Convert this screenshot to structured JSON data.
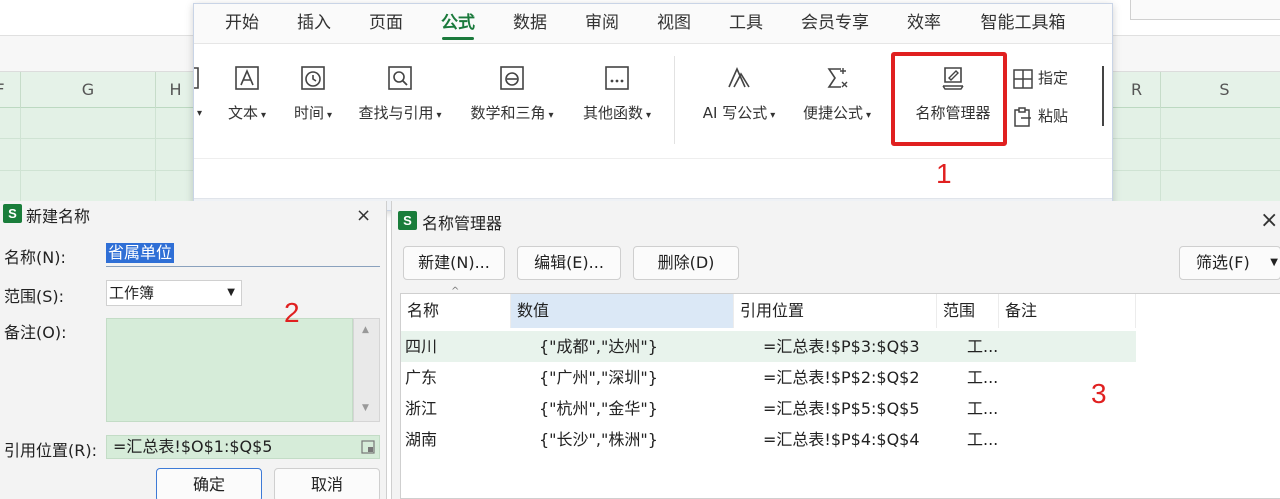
{
  "ribbon": {
    "tabs": [
      {
        "label": "开始"
      },
      {
        "label": "插入"
      },
      {
        "label": "页面"
      },
      {
        "label": "公式",
        "active": true
      },
      {
        "label": "数据"
      },
      {
        "label": "审阅"
      },
      {
        "label": "视图"
      },
      {
        "label": "工具"
      },
      {
        "label": "会员专享"
      },
      {
        "label": "效率"
      },
      {
        "label": "智能工具箱"
      }
    ],
    "tools": [
      {
        "label": "文本",
        "icon": "text-function-icon"
      },
      {
        "label": "时间",
        "icon": "time-function-icon"
      },
      {
        "label": "查找与引用",
        "icon": "lookup-reference-icon"
      },
      {
        "label": "数学和三角",
        "icon": "math-trig-icon"
      },
      {
        "label": "其他函数",
        "icon": "other-functions-icon"
      },
      {
        "label": "AI 写公式",
        "icon": "ai-formula-icon"
      },
      {
        "label": "便捷公式",
        "icon": "quick-formula-icon"
      },
      {
        "label": "名称管理器",
        "icon": "name-manager-icon"
      }
    ],
    "side_tools": [
      {
        "label": "指定",
        "icon": "define-name-icon"
      },
      {
        "label": "粘贴",
        "icon": "paste-name-icon"
      }
    ]
  },
  "sheet": {
    "col_letters": [
      "F",
      "G",
      "H",
      "R",
      "S"
    ]
  },
  "annotations": {
    "one": "1",
    "two": "2",
    "three": "3",
    "color": "#e02020"
  },
  "new_name_dialog": {
    "title": "新建名称",
    "name_label": "名称(N):",
    "name_value": "省属单位",
    "scope_label": "范围(S):",
    "scope_value": "工作簿",
    "note_label": "备注(O):",
    "ref_label": "引用位置(R):",
    "ref_value": "=汇总表!$O$1:$Q$5",
    "ok_label": "确定",
    "cancel_label": "取消",
    "close_glyph": "×"
  },
  "name_manager": {
    "title": "名称管理器",
    "close_glyph": "×",
    "buttons": {
      "new": "新建(N)...",
      "edit": "编辑(E)...",
      "delete": "删除(D)",
      "filter": "筛选(F)"
    },
    "columns": [
      "名称",
      "数值",
      "引用位置",
      "范围",
      "备注"
    ],
    "rows": [
      {
        "name": "四川",
        "value": "{\"成都\",\"达州\"}",
        "ref": "=汇总表!$P$3:$Q$3",
        "scope": "工...",
        "note": ""
      },
      {
        "name": "广东",
        "value": "{\"广州\",\"深圳\"}",
        "ref": "=汇总表!$P$2:$Q$2",
        "scope": "工...",
        "note": ""
      },
      {
        "name": "浙江",
        "value": "{\"杭州\",\"金华\"}",
        "ref": "=汇总表!$P$5:$Q$5",
        "scope": "工...",
        "note": ""
      },
      {
        "name": "湖南",
        "value": "{\"长沙\",\"株洲\"}",
        "ref": "=汇总表!$P$4:$Q$4",
        "scope": "工...",
        "note": ""
      }
    ]
  },
  "colors": {
    "accent_green": "#1b7a3c",
    "app_badge": "#1a7d3b",
    "selection_blue": "#2f6fd6",
    "grid_green": "#e3f1e6"
  }
}
